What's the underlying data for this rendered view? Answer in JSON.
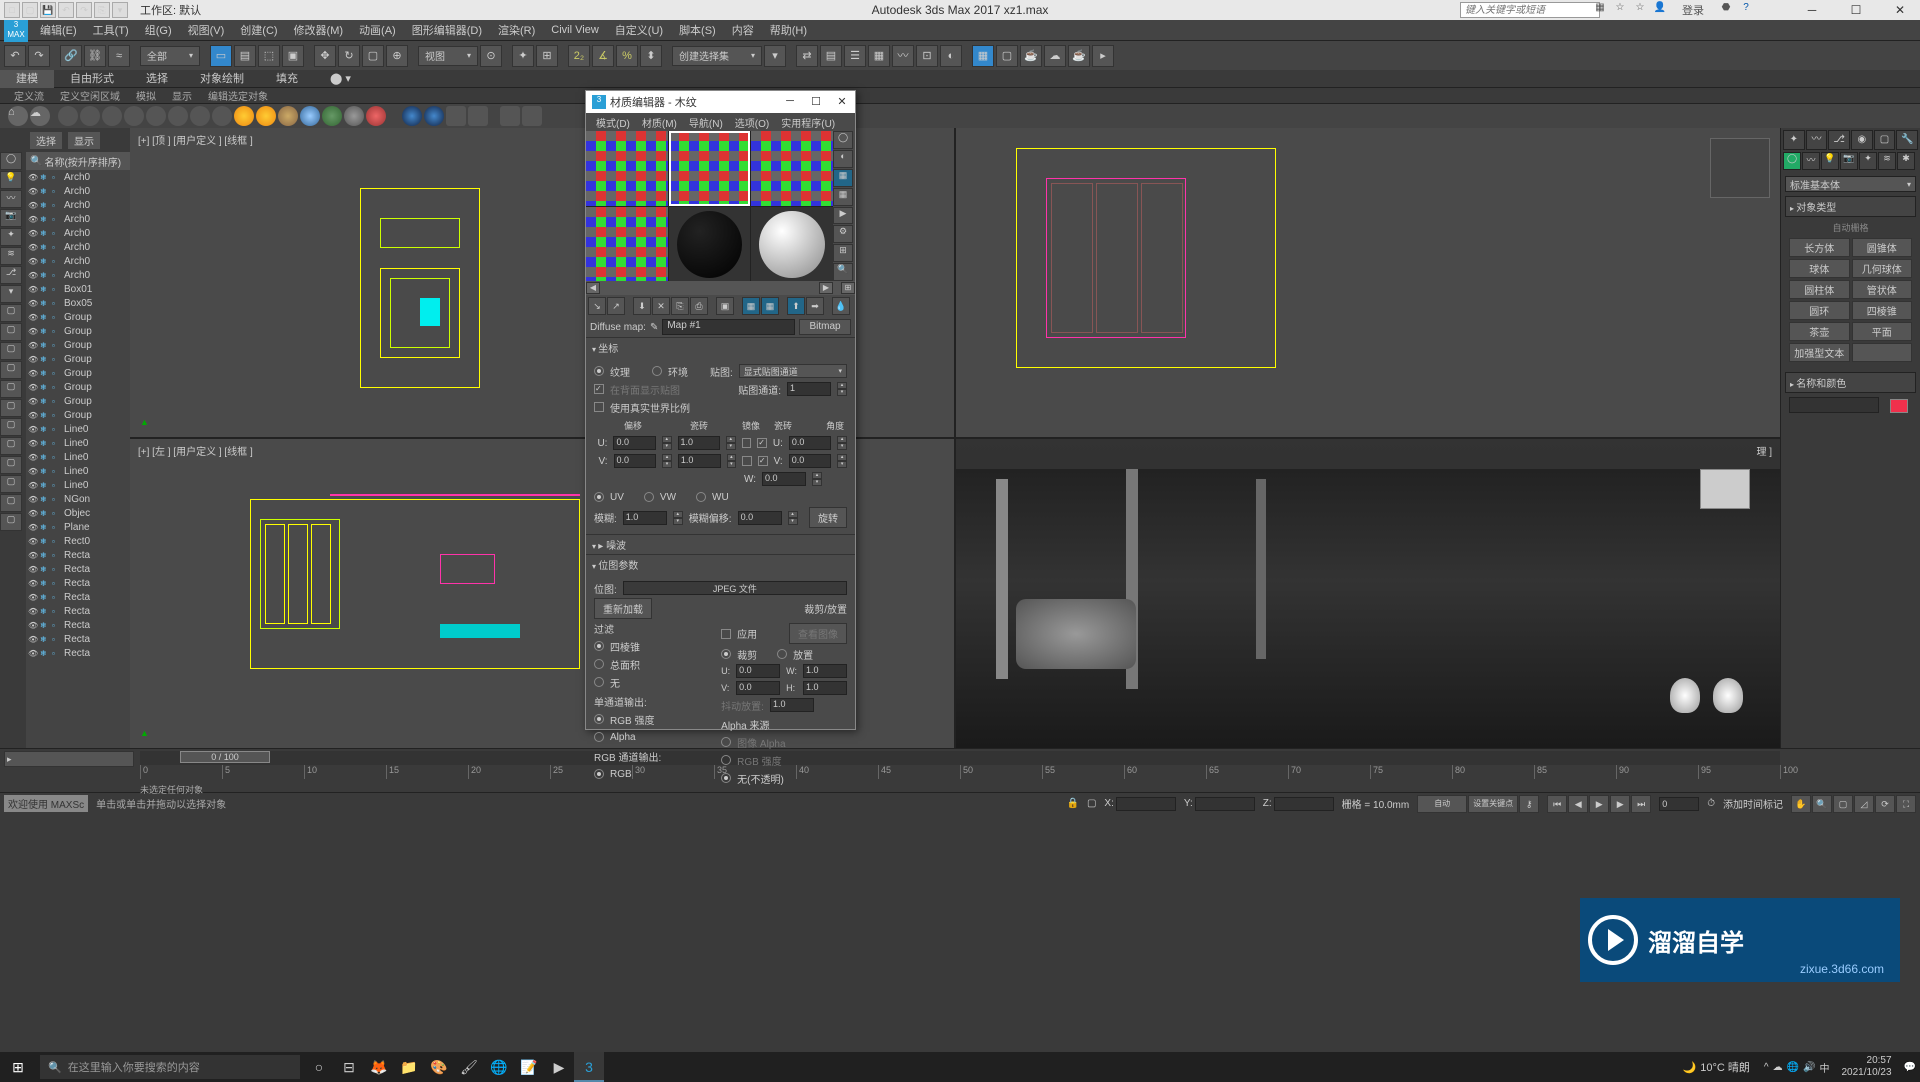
{
  "title_bar": {
    "workspace_label": "工作区: 默认",
    "app_title": "Autodesk 3ds Max 2017    xz1.max",
    "search_placeholder": "键入关键字或短语",
    "login": "登录"
  },
  "main_menu": [
    "编辑(E)",
    "工具(T)",
    "组(G)",
    "视图(V)",
    "创建(C)",
    "修改器(M)",
    "动画(A)",
    "图形编辑器(D)",
    "渲染(R)",
    "Civil View",
    "自定义(U)",
    "脚本(S)",
    "内容",
    "帮助(H)"
  ],
  "main_toolbar": {
    "dropdown1": "全部",
    "dropdown2": "视图",
    "dropdown3": "创建选择集"
  },
  "ribbon_tabs": [
    "建模",
    "自由形式",
    "选择",
    "对象绘制",
    "填充"
  ],
  "ribbon_sub": [
    "定义流",
    "定义空闲区域",
    "模拟",
    "显示",
    "编辑选定对象"
  ],
  "scene_explorer": {
    "header_btns": [
      "选择",
      "显示"
    ],
    "col_head": "名称(按升序排序)",
    "items": [
      "Arch0",
      "Arch0",
      "Arch0",
      "Arch0",
      "Arch0",
      "Arch0",
      "Arch0",
      "Arch0",
      "Box01",
      "Box05",
      "Group",
      "Group",
      "Group",
      "Group",
      "Group",
      "Group",
      "Group",
      "Group",
      "Line0",
      "Line0",
      "Line0",
      "Line0",
      "Line0",
      "NGon",
      "Objec",
      "Plane",
      "Rect0",
      "Recta",
      "Recta",
      "Recta",
      "Recta",
      "Recta",
      "Recta",
      "Recta",
      "Recta"
    ]
  },
  "viewports": {
    "vp1": "[+] [顶 ] [用户定义 ] [线框 ]",
    "vp2": "",
    "vp3": "[+] [左 ] [用户定义 ] [线框 ]",
    "vp4": "理 ]"
  },
  "cmd_panel": {
    "category": "标准基本体",
    "rollup1": "对象类型",
    "auto_grid": "自动栅格",
    "buttons": [
      [
        "长方体",
        "圆锥体"
      ],
      [
        "球体",
        "几何球体"
      ],
      [
        "圆柱体",
        "管状体"
      ],
      [
        "圆环",
        "四棱锥"
      ],
      [
        "茶壶",
        "平面"
      ],
      [
        "加强型文本",
        ""
      ]
    ],
    "rollup2": "名称和颜色"
  },
  "mat_editor": {
    "title": "材质编辑器 - 木纹",
    "menu": [
      "模式(D)",
      "材质(M)",
      "导航(N)",
      "选项(O)",
      "实用程序(U)"
    ],
    "diffuse_label": "Diffuse map:",
    "map_name": "Map #1",
    "type_btn": "Bitmap",
    "rollup_coords": "坐标",
    "tex_radio": "纹理",
    "env_radio": "环境",
    "mapping_label": "贴图:",
    "mapping_value": "显式贴图通道",
    "back_label": "在背面显示贴图",
    "channel_label": "贴图通道:",
    "channel_value": "1",
    "real_world": "使用真实世界比例",
    "col_offset": "偏移",
    "col_tile": "瓷砖",
    "col_mirror": "镜像",
    "col_tile2": "瓷砖",
    "col_angle": "角度",
    "u_label": "U:",
    "v_label": "V:",
    "w_label": "W:",
    "u_offset": "0.0",
    "u_tile": "1.0",
    "u_angle": "0.0",
    "v_offset": "0.0",
    "v_tile": "1.0",
    "v_angle": "0.0",
    "w_angle": "0.0",
    "uv_radio": "UV",
    "vw_radio": "VW",
    "wu_radio": "WU",
    "blur_label": "模糊:",
    "blur_val": "1.0",
    "blur_off_label": "模糊偏移:",
    "blur_off_val": "0.0",
    "rotate_btn": "旋转",
    "rollup_noise": "噪波",
    "rollup_bitmap": "位图参数",
    "bitmap_label": "位图:",
    "bitmap_value": "JPEG 文件",
    "reload_btn": "重新加载",
    "crop_label": "裁剪/放置",
    "apply_check": "应用",
    "view_btn": "查看图像",
    "crop_radio": "裁剪",
    "place_radio": "放置",
    "crop_u": "U:",
    "crop_v": "V:",
    "crop_w": "W:",
    "crop_h": "H:",
    "crop_u_val": "0.0",
    "crop_v_val": "0.0",
    "crop_w_val": "1.0",
    "crop_h_val": "1.0",
    "filter_label": "过滤",
    "filter_pyramid": "四棱锥",
    "filter_sa": "总面积",
    "filter_none": "无",
    "jitter_label": "抖动放置:",
    "jitter_val": "1.0",
    "mono_label": "单通道输出:",
    "mono_rgb": "RGB 强度",
    "mono_alpha": "Alpha",
    "alpha_src_label": "Alpha 来源",
    "alpha_img": "图像 Alpha",
    "alpha_rgb": "RGB 强度",
    "alpha_none": "无(不透明)",
    "rgb_out_label": "RGB 通道输出:",
    "rgb_out_rgb": "RGB"
  },
  "timeline": {
    "slider": "0 / 100",
    "ticks": [
      "0",
      "5",
      "10",
      "15",
      "20",
      "25",
      "30",
      "35",
      "40",
      "45",
      "50",
      "55",
      "60",
      "65",
      "70",
      "75",
      "80",
      "85",
      "90",
      "95",
      "100"
    ],
    "sel_text": "未选定任何对象",
    "setkey": ""
  },
  "status": {
    "welcome": "欢迎使用 MAXSc",
    "script": "单击或单击并拖动以选择对象",
    "x_label": "X:",
    "y_label": "Y:",
    "z_label": "Z:",
    "grid": "栅格 = 10.0mm",
    "addtime": "添加时间标记"
  },
  "watermark": {
    "text": "溜溜自学",
    "url": "zixue.3d66.com"
  },
  "taskbar": {
    "search": "在这里输入你要搜索的内容",
    "weather": "10°C 晴朗",
    "time": "20:57",
    "date": "2021/10/23"
  }
}
